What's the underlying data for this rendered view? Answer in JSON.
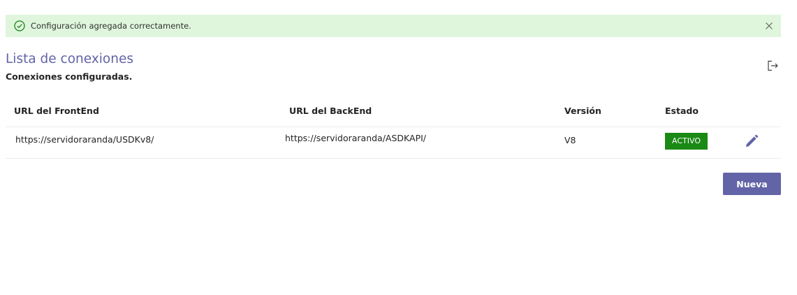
{
  "banner": {
    "icon": "check-circle-icon",
    "message": "Configuración agregada correctamente.",
    "close_icon": "close-icon",
    "color": "#dff6dd"
  },
  "header": {
    "title": "Lista de conexiones",
    "subtitle": "Conexiones configuradas.",
    "action_icon": "sign-out-icon",
    "accent_color": "#6264a7"
  },
  "table": {
    "columns": [
      "URL del FrontEnd",
      "URL del BackEnd",
      "Versión",
      "Estado"
    ],
    "rows": [
      {
        "frontend_url": "https://servidoraranda/USDKv8/",
        "backend_url": "https://servidoraranda/ASDKAPI/",
        "version": "V8",
        "status": "ACTIVO",
        "status_color": "#1a8a14",
        "edit_icon": "pencil-icon"
      }
    ]
  },
  "actions": {
    "new_label": "Nueva"
  }
}
